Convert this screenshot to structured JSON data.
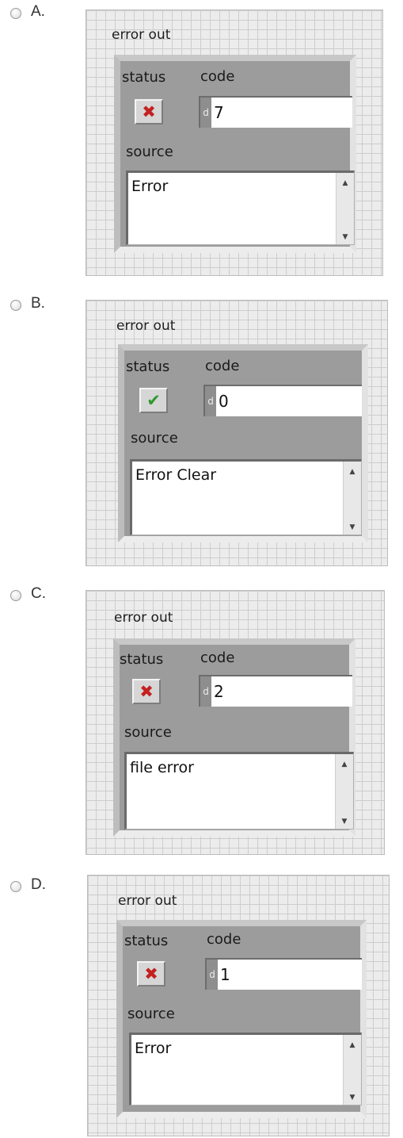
{
  "options": [
    {
      "letter": "A.",
      "title": "error out",
      "status_label": "status",
      "code_label": "code",
      "source_label": "source",
      "radix": "d",
      "status": "error",
      "status_symbol": "✖",
      "code": "7",
      "source": "Error",
      "scroll_up": "▲",
      "scroll_down": "▼"
    },
    {
      "letter": "B.",
      "title": "error out",
      "status_label": "status",
      "code_label": "code",
      "source_label": "source",
      "radix": "d",
      "status": "ok",
      "status_symbol": "✔",
      "code": "0",
      "source": "Error Clear",
      "scroll_up": "▲",
      "scroll_down": "▼"
    },
    {
      "letter": "C.",
      "title": "error out",
      "status_label": "status",
      "code_label": "code",
      "source_label": "source",
      "radix": "d",
      "status": "error",
      "status_symbol": "✖",
      "code": "2",
      "source": "file error",
      "scroll_up": "▲",
      "scroll_down": "▼"
    },
    {
      "letter": "D.",
      "title": "error out",
      "status_label": "status",
      "code_label": "code",
      "source_label": "source",
      "radix": "d",
      "status": "error",
      "status_symbol": "✖",
      "code": "1",
      "source": "Error",
      "scroll_up": "▲",
      "scroll_down": "▼"
    }
  ],
  "colors": {
    "error": "#c42121",
    "ok": "#2e9a2e",
    "cluster": "#9c9c9c",
    "panel": "#ececec"
  }
}
